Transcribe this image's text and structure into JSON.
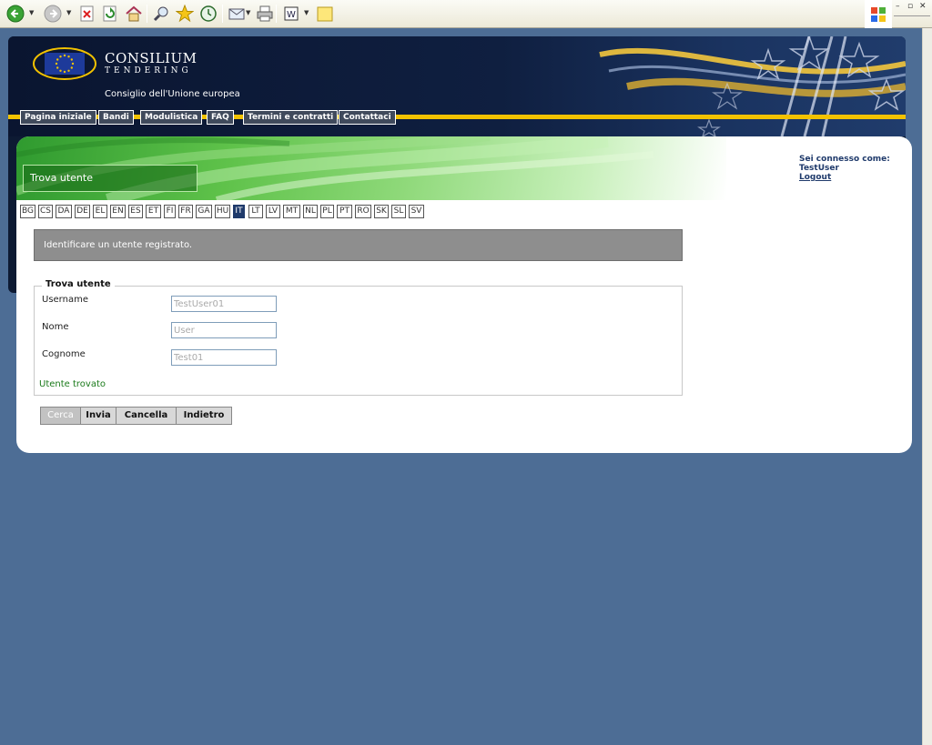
{
  "browser": {
    "toolbar_icons": [
      "back-icon",
      "forward-icon",
      "stop-icon",
      "refresh-icon",
      "home-icon",
      "search-icon",
      "favorites-icon",
      "history-icon",
      "mail-icon",
      "print-icon",
      "edit-icon",
      "notes-icon"
    ],
    "window_controls": [
      "–",
      "▫",
      "✕"
    ]
  },
  "header": {
    "brand_top": "CONSILIUM",
    "brand_bottom": "TENDERING",
    "council_name": "Consiglio dell'Unione europea",
    "nav": [
      "Pagina iniziale",
      "Bandi",
      "Modulistica",
      "FAQ",
      "Termini e contratti",
      "Contattaci"
    ]
  },
  "page": {
    "title": "Trova utente",
    "user_label": "Sei connesso come:",
    "user_name": "TestUser",
    "logout": "Logout"
  },
  "languages": {
    "items": [
      "BG",
      "CS",
      "DA",
      "DE",
      "EL",
      "EN",
      "ES",
      "ET",
      "FI",
      "FR",
      "GA",
      "HU",
      "IT",
      "LT",
      "LV",
      "MT",
      "NL",
      "PL",
      "PT",
      "RO",
      "SK",
      "SL",
      "SV"
    ],
    "active": "IT"
  },
  "info": "Identificare un utente registrato.",
  "form": {
    "legend": "Trova utente",
    "username_label": "Username",
    "username_value": "TestUser01",
    "nome_label": "Nome",
    "nome_value": "User",
    "cognome_label": "Cognome",
    "cognome_value": "Test01",
    "status": "Utente trovato"
  },
  "buttons": {
    "cerca": "Cerca",
    "invia": "Invia",
    "cancella": "Cancella",
    "indietro": "Indietro"
  },
  "colors": {
    "background": "#4d6d95",
    "header": "#0d1a33",
    "accent_yellow": "#f2c200",
    "active_lang": "#1f3a6b",
    "success_text": "#1a7a1a"
  }
}
